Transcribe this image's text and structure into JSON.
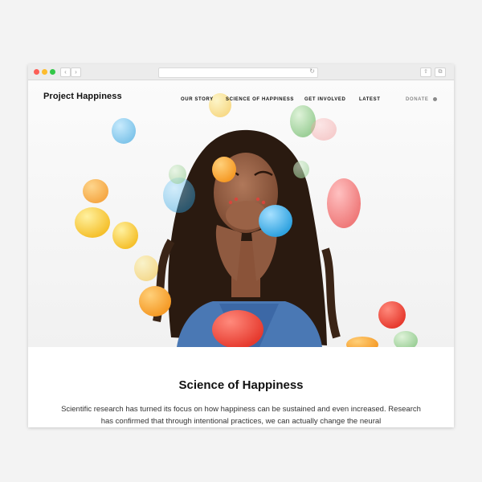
{
  "site": {
    "logo": "Project Happiness",
    "nav": [
      "OUR STORY",
      "SCIENCE OF HAPPINESS",
      "GET INVOLVED",
      "LATEST"
    ],
    "donate": "DONATE"
  },
  "browser": {
    "back_icon": "‹",
    "forward_icon": "›",
    "reload_icon": "↻",
    "share_icon": "⇧",
    "tabs_icon": "⧉"
  },
  "section": {
    "title": "Science of Happiness",
    "body": "Scientific research has turned its focus on how happiness can be sustained and even increased. Research has confirmed that through intentional practices, we can actually change the neural"
  },
  "colors": {
    "balloon_red": "#ef4a3c",
    "balloon_orange": "#f7a23a",
    "balloon_yellow": "#f8c93a",
    "balloon_blue": "#4fb3e8",
    "balloon_green": "#a9d9a6",
    "shirt": "#4a78b4",
    "hair": "#2a1a10"
  }
}
